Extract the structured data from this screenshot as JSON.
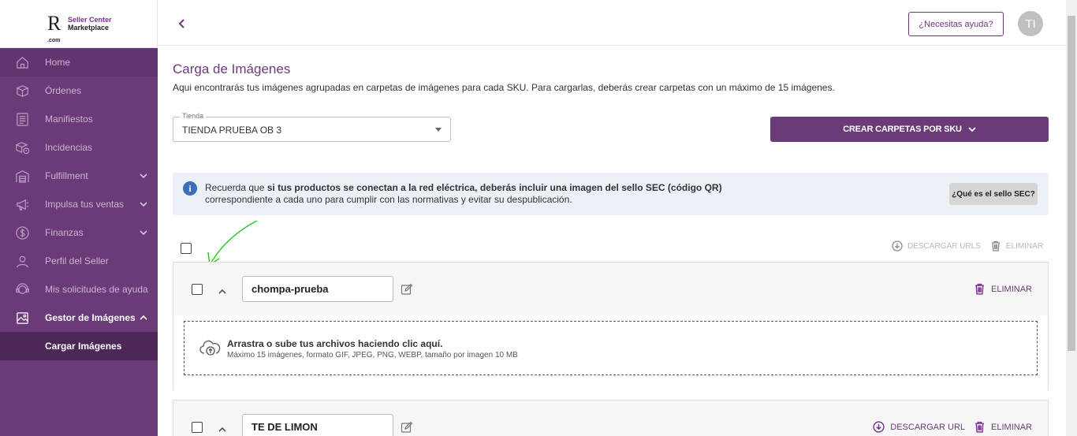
{
  "logo": {
    "mark": "R",
    "suffix": ".com",
    "line1": "Seller Center",
    "line2": "Marketplace"
  },
  "sidebar": {
    "items": [
      {
        "label": "Home",
        "icon": "home-icon"
      },
      {
        "label": "Órdenes",
        "icon": "box-icon"
      },
      {
        "label": "Manifiestos",
        "icon": "document-list-icon"
      },
      {
        "label": "Incidencias",
        "icon": "package-alert-icon"
      },
      {
        "label": "Fulfillment",
        "icon": "warehouse-icon"
      },
      {
        "label": "Impulsa tus ventas",
        "icon": "megaphone-icon"
      },
      {
        "label": "Finanzas",
        "icon": "dollar-circle-icon"
      },
      {
        "label": "Perfil del Seller",
        "icon": "user-icon"
      },
      {
        "label": "Mis solicitudes de ayuda",
        "icon": "support-headset-icon"
      },
      {
        "label": "Gestor de Imágenes",
        "icon": "image-icon"
      },
      {
        "label": "Cargar Imágenes"
      }
    ]
  },
  "header": {
    "help_label": "¿Necesitas ayuda?",
    "avatar_initials": "TI"
  },
  "main": {
    "title": "Carga de Imágenes",
    "description": "Aqui encontrarás tus imágenes agrupadas en carpetas de imágenes para cada SKU. Para cargarlas, deberás crear carpetas con un máximo de 15 imágenes.",
    "store_legend": "Tienda",
    "store_value": "TIENDA PRUEBA OB 3",
    "create_button": "CREAR CARPETAS POR SKU",
    "info": {
      "prefix": "Recuerda que ",
      "bold": "si tus productos se conectan a la red eléctrica, deberás incluir una imagen del sello SEC (código QR)",
      "line2": "correspondiente a cada uno para cumplir con las normativas y evitar su despublicación.",
      "button": "¿Qué es el sello SEC?"
    },
    "bulk_actions": {
      "download": "DESCARGAR URLS",
      "delete": "ELIMINAR"
    },
    "folders": [
      {
        "name": "chompa-prueba",
        "delete": "ELIMINAR",
        "dropzone_title": "Arrastra o sube tus archivos haciendo clic aquí.",
        "dropzone_sub": "Máximo 15 imágenes, formato GIF, JPEG, PNG, WEBP, tamaño por imagen 10 MB"
      },
      {
        "name": "TE DE LIMON",
        "download": "DESCARGAR URL",
        "delete": "ELIMINAR"
      }
    ]
  },
  "colors": {
    "brand": "#6b3a78",
    "sidebar": "#6b3a78",
    "info_bg": "#ecf0f7",
    "annotation": "#22c51e"
  }
}
